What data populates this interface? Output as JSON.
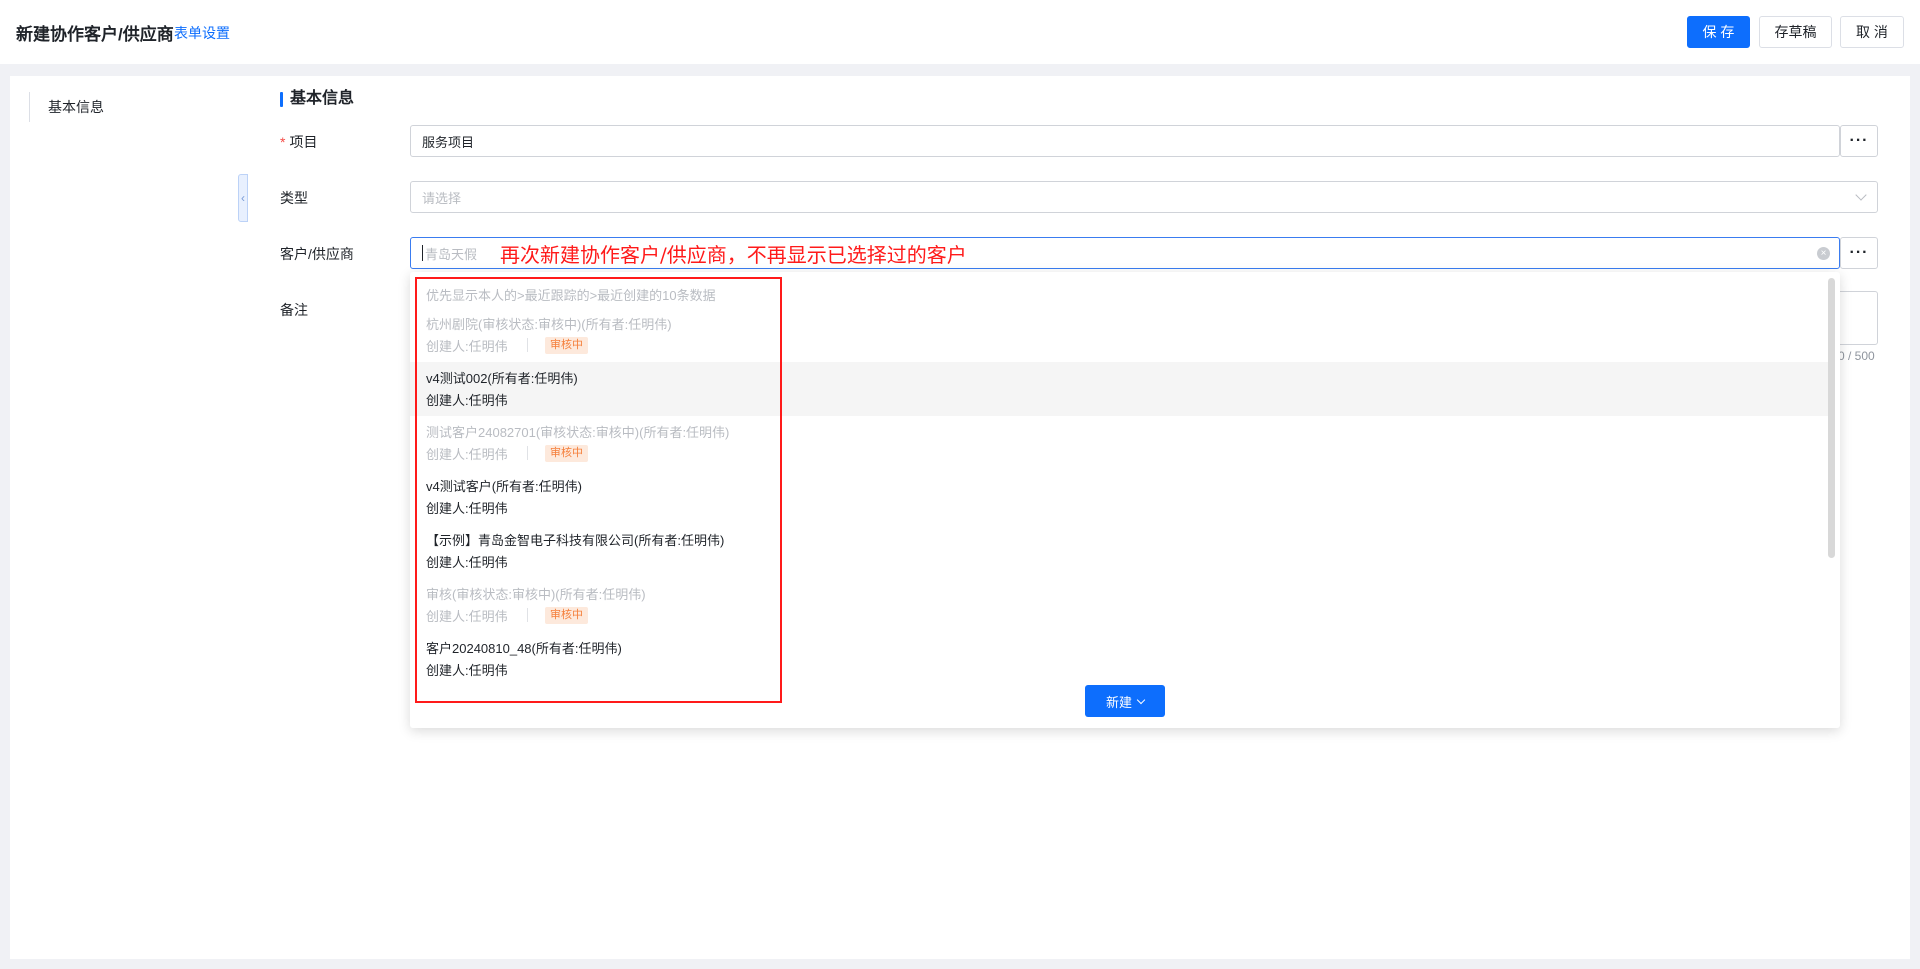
{
  "header": {
    "title": "新建协作客户/供应商",
    "form_settings": "表单设置",
    "save": "保 存",
    "draft": "存草稿",
    "cancel": "取 消"
  },
  "sidebar": {
    "items": [
      {
        "label": "基本信息"
      }
    ],
    "collapse_glyph": "‹"
  },
  "section": {
    "title": "基本信息"
  },
  "fields": {
    "project": {
      "required_mark": "*",
      "label": "项目",
      "value": "服务项目",
      "more": "···"
    },
    "type": {
      "label": "类型",
      "placeholder": "请选择"
    },
    "customer": {
      "label": "客户/供应商",
      "placeholder": "青岛天假",
      "more": "···",
      "clear": "×"
    },
    "remark": {
      "label": "备注",
      "count": "0 / 500"
    }
  },
  "annotation": "再次新建协作客户/供应商，不再显示已选择过的客户",
  "dropdown": {
    "hint": "优先显示本人的>最近跟踪的>最近创建的10条数据",
    "items": [
      {
        "name": "杭州剧院(审核状态:审核中)(所有者:任明伟)",
        "creator": "创建人:任明伟",
        "badge": "审核中"
      },
      {
        "name": "v4测试002(所有者:任明伟)",
        "creator": "创建人:任明伟"
      },
      {
        "name": "测试客户24082701(审核状态:审核中)(所有者:任明伟)",
        "creator": "创建人:任明伟",
        "badge": "审核中"
      },
      {
        "name": "v4测试客户(所有者:任明伟)",
        "creator": "创建人:任明伟"
      },
      {
        "name": "【示例】青岛金智电子科技有限公司(所有者:任明伟)",
        "creator": "创建人:任明伟"
      },
      {
        "name": "审核(审核状态:审核中)(所有者:任明伟)",
        "creator": "创建人:任明伟",
        "badge": "审核中"
      },
      {
        "name": "客户20240810_48(所有者:任明伟)",
        "creator": "创建人:任明伟"
      }
    ],
    "new_button": "新建"
  },
  "colors": {
    "primary": "#0d6efd",
    "annotation": "#ff1a1a",
    "badge_bg": "#fde9dc",
    "badge_text": "#f57f3b"
  }
}
